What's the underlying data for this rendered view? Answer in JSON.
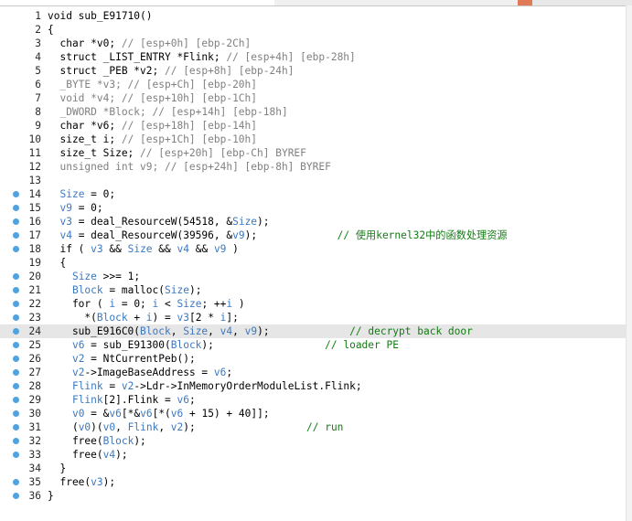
{
  "colors": {
    "code_default": "#000000",
    "line_number": "#2b2b2b",
    "variable_blue": "#3b78c2",
    "comment_gray": "#808080",
    "comment_green": "#127c12",
    "breakpoint_dot": "#4fa3e0",
    "current_line_highlight": "#e6e6e6"
  },
  "code_lines": [
    {
      "num": "1",
      "dot": false,
      "tokens": [
        [
          "void sub_E91710()",
          ""
        ]
      ]
    },
    {
      "num": "2",
      "dot": false,
      "tokens": [
        [
          "{",
          ""
        ]
      ]
    },
    {
      "num": "3",
      "dot": false,
      "tokens": [
        [
          "  char *v0; ",
          ""
        ],
        [
          "// [esp+0h] [ebp-2Ch]",
          "gray"
        ]
      ]
    },
    {
      "num": "4",
      "dot": false,
      "tokens": [
        [
          "  struct _LIST_ENTRY *Flink; ",
          ""
        ],
        [
          "// [esp+4h] [ebp-28h]",
          "gray"
        ]
      ]
    },
    {
      "num": "5",
      "dot": false,
      "tokens": [
        [
          "  struct _PEB *v2; ",
          ""
        ],
        [
          "// [esp+8h] [ebp-24h]",
          "gray"
        ]
      ]
    },
    {
      "num": "6",
      "dot": false,
      "tokens": [
        [
          "  _BYTE *v3; // [esp+Ch] [ebp-20h]",
          "gray"
        ]
      ]
    },
    {
      "num": "7",
      "dot": false,
      "tokens": [
        [
          "  void *v4; // [esp+10h] [ebp-1Ch]",
          "gray"
        ]
      ]
    },
    {
      "num": "8",
      "dot": false,
      "tokens": [
        [
          "  _DWORD *Block; // [esp+14h] [ebp-18h]",
          "gray"
        ]
      ]
    },
    {
      "num": "9",
      "dot": false,
      "tokens": [
        [
          "  char *v6; ",
          ""
        ],
        [
          "// [esp+18h] [ebp-14h]",
          "gray"
        ]
      ]
    },
    {
      "num": "10",
      "dot": false,
      "tokens": [
        [
          "  size_t i; ",
          ""
        ],
        [
          "// [esp+1Ch] [ebp-10h]",
          "gray"
        ]
      ]
    },
    {
      "num": "11",
      "dot": false,
      "tokens": [
        [
          "  size_t Size; ",
          ""
        ],
        [
          "// [esp+20h] [ebp-Ch] BYREF",
          "gray"
        ]
      ]
    },
    {
      "num": "12",
      "dot": false,
      "tokens": [
        [
          "  unsigned int v9; // [esp+24h] [ebp-8h] BYREF",
          "gray"
        ]
      ]
    },
    {
      "num": "13",
      "dot": false,
      "tokens": [
        [
          "",
          ""
        ]
      ]
    },
    {
      "num": "14",
      "dot": true,
      "tokens": [
        [
          "  ",
          ""
        ],
        [
          "Size",
          "blue"
        ],
        [
          " = 0;",
          ""
        ]
      ]
    },
    {
      "num": "15",
      "dot": true,
      "tokens": [
        [
          "  ",
          ""
        ],
        [
          "v9",
          "blue"
        ],
        [
          " = 0;",
          ""
        ]
      ]
    },
    {
      "num": "16",
      "dot": true,
      "tokens": [
        [
          "  ",
          ""
        ],
        [
          "v3",
          "blue"
        ],
        [
          " = deal_ResourceW(54518, &",
          ""
        ],
        [
          "Size",
          "blue"
        ],
        [
          ");",
          ""
        ]
      ]
    },
    {
      "num": "17",
      "dot": true,
      "tokens": [
        [
          "  ",
          ""
        ],
        [
          "v4",
          "blue"
        ],
        [
          " = deal_ResourceW(39596, &",
          ""
        ],
        [
          "v9",
          "blue"
        ],
        [
          ");             ",
          ""
        ],
        [
          "// 使用kernel32中的函数处理资源",
          "green"
        ]
      ]
    },
    {
      "num": "18",
      "dot": true,
      "tokens": [
        [
          "  if ( ",
          ""
        ],
        [
          "v3",
          "blue"
        ],
        [
          " && ",
          ""
        ],
        [
          "Size",
          "blue"
        ],
        [
          " && ",
          ""
        ],
        [
          "v4",
          "blue"
        ],
        [
          " && ",
          ""
        ],
        [
          "v9",
          "blue"
        ],
        [
          " )",
          ""
        ]
      ]
    },
    {
      "num": "19",
      "dot": false,
      "tokens": [
        [
          "  {",
          ""
        ]
      ]
    },
    {
      "num": "20",
      "dot": true,
      "tokens": [
        [
          "    ",
          ""
        ],
        [
          "Size",
          "blue"
        ],
        [
          " >>= 1;",
          ""
        ]
      ]
    },
    {
      "num": "21",
      "dot": true,
      "tokens": [
        [
          "    ",
          ""
        ],
        [
          "Block",
          "blue"
        ],
        [
          " = malloc(",
          ""
        ],
        [
          "Size",
          "blue"
        ],
        [
          ");",
          ""
        ]
      ]
    },
    {
      "num": "22",
      "dot": true,
      "tokens": [
        [
          "    for ( ",
          ""
        ],
        [
          "i",
          "blue"
        ],
        [
          " = 0; ",
          ""
        ],
        [
          "i",
          "blue"
        ],
        [
          " < ",
          ""
        ],
        [
          "Size",
          "blue"
        ],
        [
          "; ++",
          ""
        ],
        [
          "i",
          "blue"
        ],
        [
          " )",
          ""
        ]
      ]
    },
    {
      "num": "23",
      "dot": true,
      "tokens": [
        [
          "      *(",
          ""
        ],
        [
          "Block",
          "blue"
        ],
        [
          " + ",
          ""
        ],
        [
          "i",
          "blue"
        ],
        [
          ") = ",
          ""
        ],
        [
          "v3",
          "blue"
        ],
        [
          "[2 * ",
          ""
        ],
        [
          "i",
          "blue"
        ],
        [
          "];",
          ""
        ]
      ]
    },
    {
      "num": "24",
      "dot": true,
      "highlight": true,
      "tokens": [
        [
          "    sub_E916C0(",
          ""
        ],
        [
          "Block",
          "blue"
        ],
        [
          ", ",
          ""
        ],
        [
          "Size",
          "blue"
        ],
        [
          ", ",
          ""
        ],
        [
          "v4",
          "blue"
        ],
        [
          ", ",
          ""
        ],
        [
          "v9",
          "blue"
        ],
        [
          ");             ",
          ""
        ],
        [
          "// decrypt back door",
          "green"
        ]
      ]
    },
    {
      "num": "25",
      "dot": true,
      "tokens": [
        [
          "    ",
          ""
        ],
        [
          "v6",
          "blue"
        ],
        [
          " = sub_E91300(",
          ""
        ],
        [
          "Block",
          "blue"
        ],
        [
          ");                  ",
          ""
        ],
        [
          "// loader PE",
          "green"
        ]
      ]
    },
    {
      "num": "26",
      "dot": true,
      "tokens": [
        [
          "    ",
          ""
        ],
        [
          "v2",
          "blue"
        ],
        [
          " = NtCurrentPeb();",
          ""
        ]
      ]
    },
    {
      "num": "27",
      "dot": true,
      "tokens": [
        [
          "    ",
          ""
        ],
        [
          "v2",
          "blue"
        ],
        [
          "->ImageBaseAddress = ",
          ""
        ],
        [
          "v6",
          "blue"
        ],
        [
          ";",
          ""
        ]
      ]
    },
    {
      "num": "28",
      "dot": true,
      "tokens": [
        [
          "    ",
          ""
        ],
        [
          "Flink",
          "blue"
        ],
        [
          " = ",
          ""
        ],
        [
          "v2",
          "blue"
        ],
        [
          "->Ldr->InMemoryOrderModuleList.Flink;",
          ""
        ]
      ]
    },
    {
      "num": "29",
      "dot": true,
      "tokens": [
        [
          "    ",
          ""
        ],
        [
          "Flink",
          "blue"
        ],
        [
          "[2].Flink = ",
          ""
        ],
        [
          "v6",
          "blue"
        ],
        [
          ";",
          ""
        ]
      ]
    },
    {
      "num": "30",
      "dot": true,
      "tokens": [
        [
          "    ",
          ""
        ],
        [
          "v0",
          "blue"
        ],
        [
          " = &",
          ""
        ],
        [
          "v6",
          "blue"
        ],
        [
          "[*&",
          ""
        ],
        [
          "v6",
          "blue"
        ],
        [
          "[*(",
          ""
        ],
        [
          "v6",
          "blue"
        ],
        [
          " + 15) + 40]];",
          ""
        ]
      ]
    },
    {
      "num": "31",
      "dot": true,
      "tokens": [
        [
          "    (",
          ""
        ],
        [
          "v0",
          "blue"
        ],
        [
          ")(",
          ""
        ],
        [
          "v0",
          "blue"
        ],
        [
          ", ",
          ""
        ],
        [
          "Flink",
          "blue"
        ],
        [
          ", ",
          ""
        ],
        [
          "v2",
          "blue"
        ],
        [
          ");                  ",
          ""
        ],
        [
          "// run",
          "green"
        ]
      ]
    },
    {
      "num": "32",
      "dot": true,
      "tokens": [
        [
          "    free(",
          ""
        ],
        [
          "Block",
          "blue"
        ],
        [
          ");",
          ""
        ]
      ]
    },
    {
      "num": "33",
      "dot": true,
      "tokens": [
        [
          "    free(",
          ""
        ],
        [
          "v4",
          "blue"
        ],
        [
          ");",
          ""
        ]
      ]
    },
    {
      "num": "34",
      "dot": false,
      "tokens": [
        [
          "  }",
          ""
        ]
      ]
    },
    {
      "num": "35",
      "dot": true,
      "tokens": [
        [
          "  free(",
          ""
        ],
        [
          "v3",
          "blue"
        ],
        [
          ");",
          ""
        ]
      ]
    },
    {
      "num": "36",
      "dot": true,
      "tokens": [
        [
          "}",
          ""
        ]
      ]
    }
  ]
}
